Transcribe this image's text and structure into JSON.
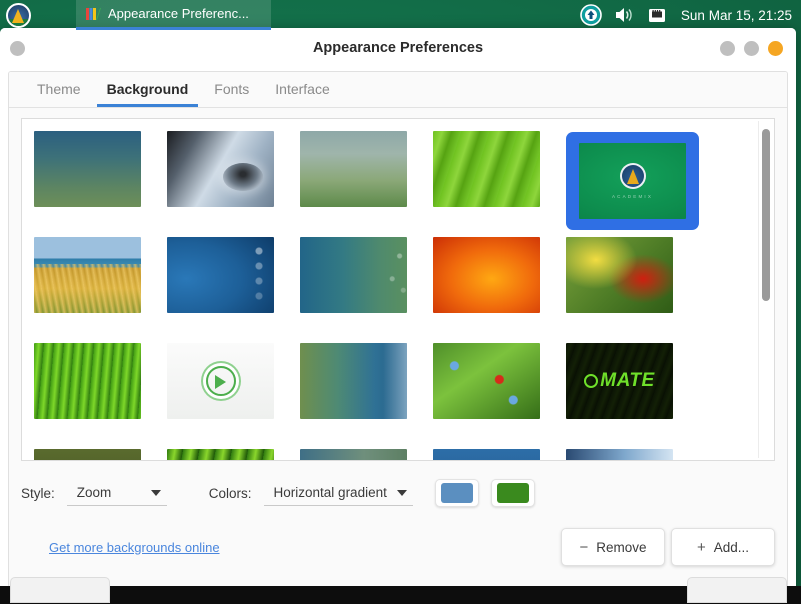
{
  "panel": {
    "menu_icon": "mate-menu-logo-icon",
    "task_button": {
      "label": "Appearance Preferenc...",
      "icon": "appearance-preferences-icon"
    },
    "tray": [
      {
        "name": "software-updater-icon",
        "glyph": "update"
      },
      {
        "name": "volume-icon",
        "glyph": "speaker"
      },
      {
        "name": "network-icon",
        "glyph": "ethernet"
      }
    ],
    "clock": "Sun Mar 15, 21:25"
  },
  "window": {
    "title": "Appearance Preferences",
    "buttons": [
      {
        "name": "minimize-button",
        "color": "#bfbfbf"
      },
      {
        "name": "maximize-button",
        "color": "#bfbfbf"
      },
      {
        "name": "close-button",
        "color": "#f5a623"
      }
    ],
    "left_dot": "window-menu-button"
  },
  "tabs": [
    {
      "label": "Theme",
      "active": false
    },
    {
      "label": "Background",
      "active": true
    },
    {
      "label": "Fonts",
      "active": false
    },
    {
      "label": "Interface",
      "active": false
    }
  ],
  "wallpapers": [
    {
      "name": "wallpaper-blue-green-gradient",
      "style": "wp-blue-green",
      "selected": false
    },
    {
      "name": "wallpaper-water-drop",
      "style": "wp-waterdrop",
      "selected": false
    },
    {
      "name": "wallpaper-soft-green-haze",
      "style": "wp-softgreen",
      "selected": false
    },
    {
      "name": "wallpaper-green-leaf",
      "style": "wp-leafgreen",
      "selected": false
    },
    {
      "name": "wallpaper-academix-logo",
      "style": "wp-academix",
      "selected": true,
      "logo_text": "ACADEMIX"
    },
    {
      "name": "wallpaper-beach-grass",
      "style": "wp-beachgrass",
      "selected": false
    },
    {
      "name": "wallpaper-blue-wave",
      "style": "wp-bluewave",
      "selected": false
    },
    {
      "name": "wallpaper-teal-gradient",
      "style": "wp-tealgrad",
      "selected": false
    },
    {
      "name": "wallpaper-orange-flower",
      "style": "wp-orangeflower",
      "selected": false
    },
    {
      "name": "wallpaper-red-yellow-flower",
      "style": "wp-redyellowflower",
      "selected": false
    },
    {
      "name": "wallpaper-green-grass",
      "style": "wp-grass",
      "selected": false
    },
    {
      "name": "wallpaper-mint-logo",
      "style": "wp-mintlogo",
      "selected": false
    },
    {
      "name": "wallpaper-green-blue-gradient",
      "style": "wp-greenbluegrad",
      "selected": false
    },
    {
      "name": "wallpaper-ladybug-flowers",
      "style": "wp-ladybug",
      "selected": false
    },
    {
      "name": "wallpaper-mate-logo",
      "style": "wp-mate",
      "selected": false,
      "logo_text": "MATE"
    },
    {
      "name": "wallpaper-olive-field",
      "style": "wp-olive",
      "selected": false
    },
    {
      "name": "wallpaper-green-stripe",
      "style": "wp-greenstripe",
      "selected": false
    },
    {
      "name": "wallpaper-grey-blue",
      "style": "wp-greyblue",
      "selected": false
    },
    {
      "name": "wallpaper-steel-blue",
      "style": "wp-steelblue",
      "selected": false
    },
    {
      "name": "wallpaper-light-blue",
      "style": "wp-lightblue",
      "selected": false
    }
  ],
  "options": {
    "style_label": "Style:",
    "style_value": "Zoom",
    "colors_label": "Colors:",
    "colors_value": "Horizontal gradient",
    "primary_color": "#5b8fc0",
    "secondary_color": "#3a8a1e"
  },
  "footer": {
    "more_link": "Get more backgrounds online",
    "remove_glyph": "−",
    "remove_label": "Remove",
    "add_glyph": "+",
    "add_label": "Add..."
  },
  "theme_colors": {
    "panel_green": "#158355",
    "accent_blue": "#3b82d6",
    "selection_blue": "#2f6fe4",
    "link_blue": "#4a86dd",
    "close_orange": "#f5a623"
  }
}
